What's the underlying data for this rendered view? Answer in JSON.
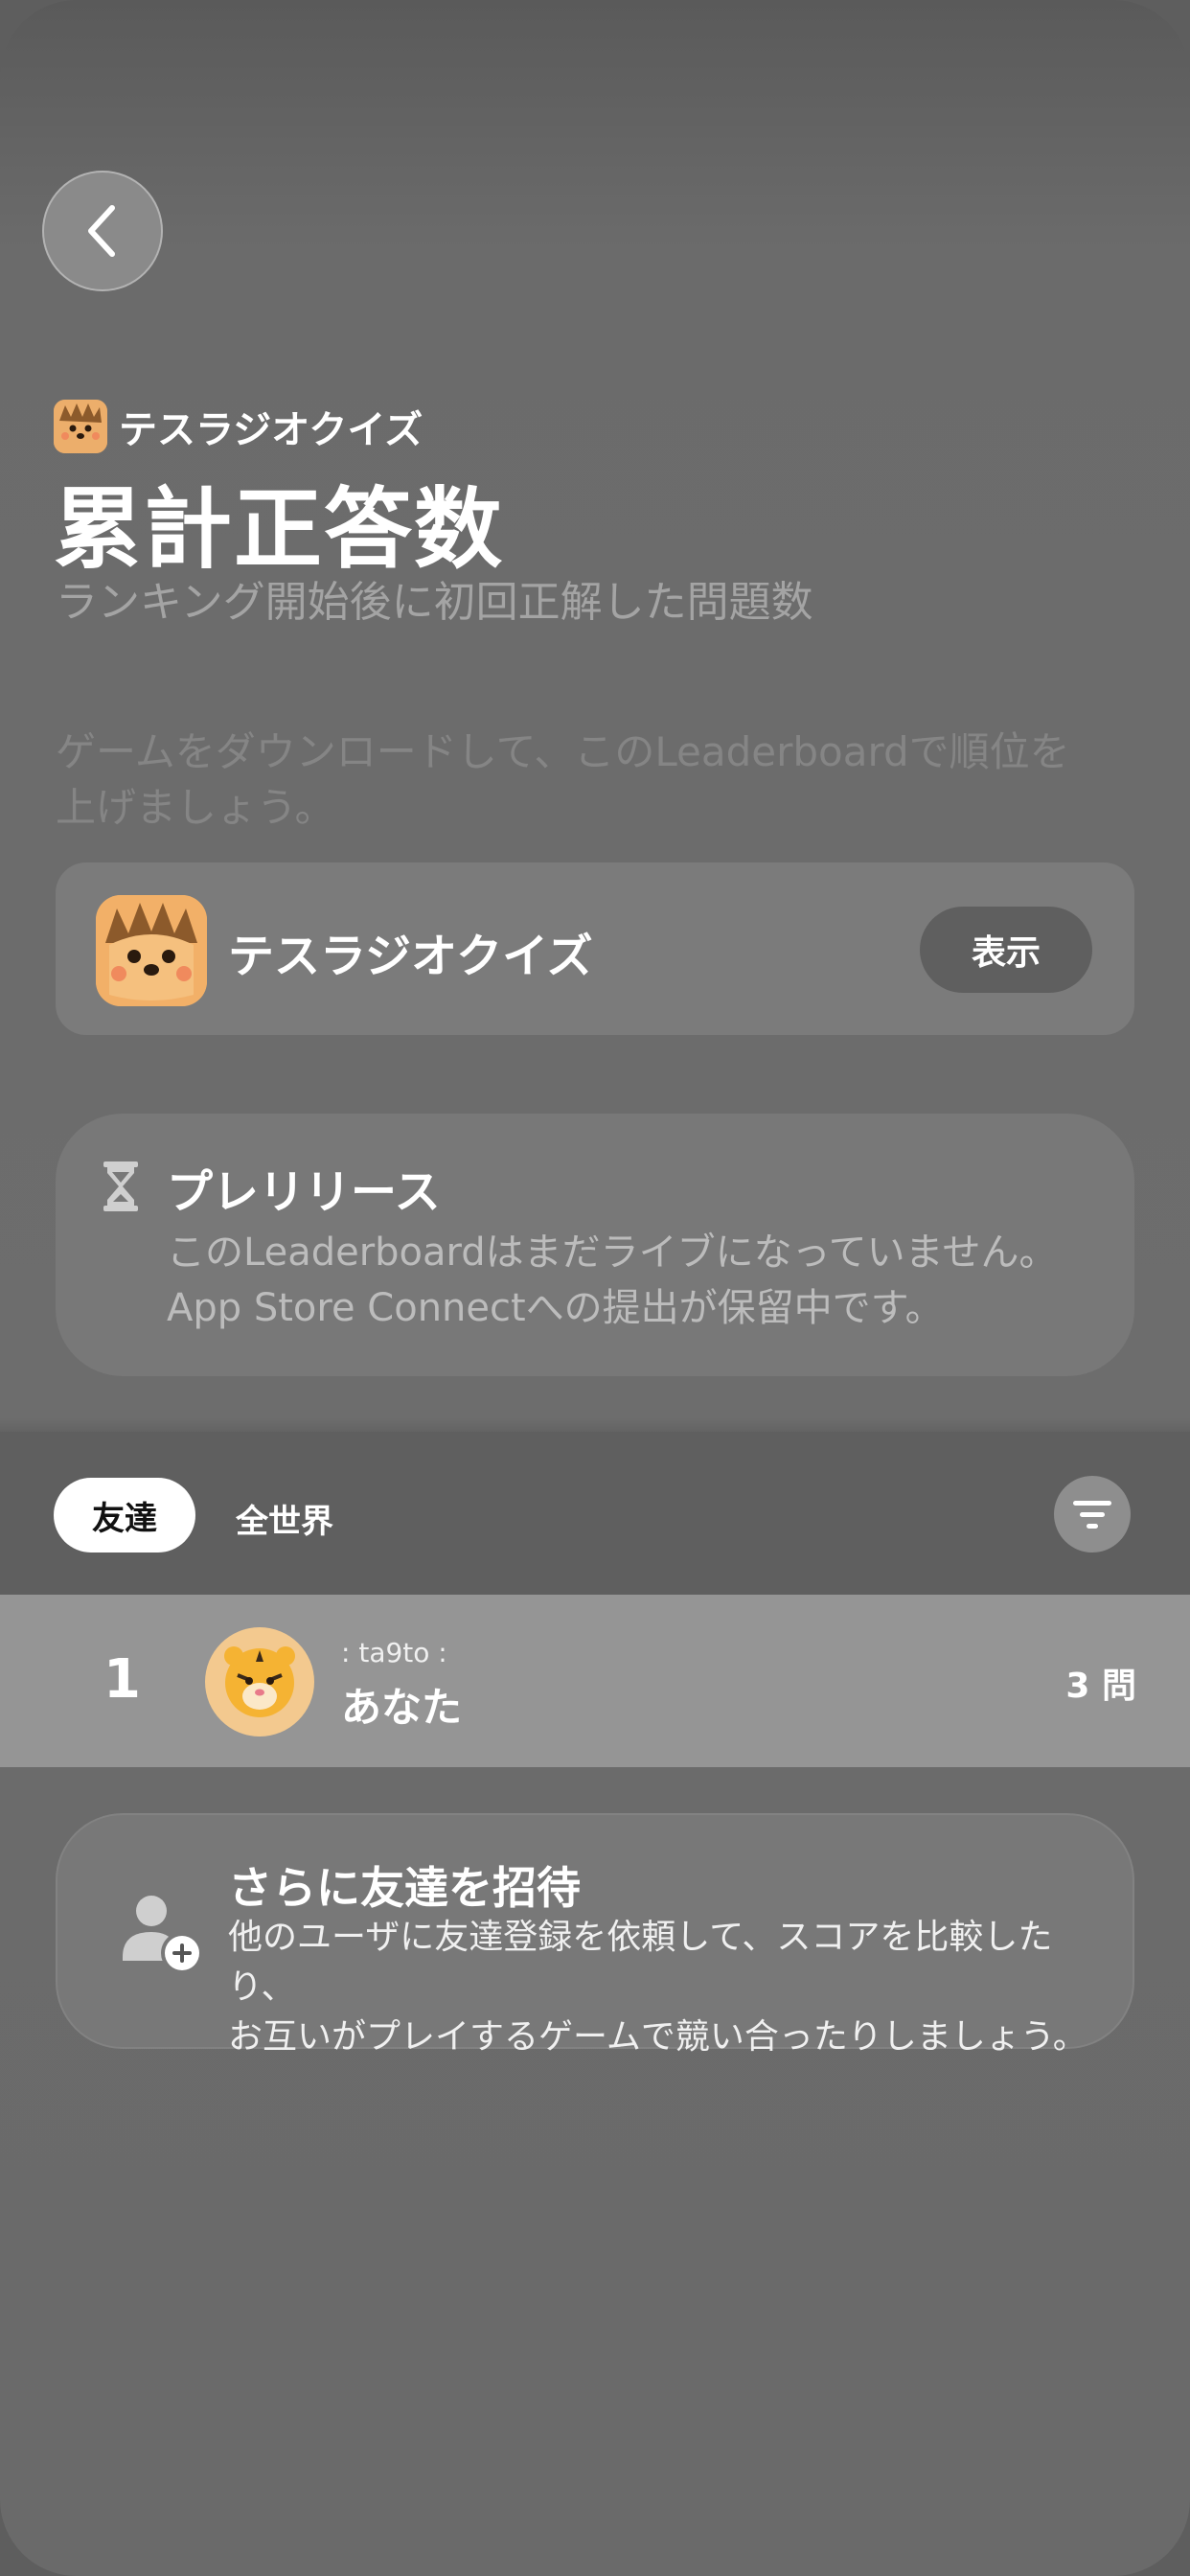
{
  "header": {
    "game_name": "テスラジオクイズ",
    "title": "累計正答数",
    "subtitle": "ランキング開始後に初回正解した問題数"
  },
  "promo": {
    "text": "ゲームをダウンロードして、このLeaderboardで順位を上げましょう。"
  },
  "game_card": {
    "name": "テスラジオクイズ",
    "view_label": "表示",
    "icon": "hedgehog-icon"
  },
  "prerelease": {
    "title": "プレリリース",
    "line1": "このLeaderboardはまだライブになっていません。",
    "line2": "App Store Connectへの提出が保留中です。",
    "icon": "hourglass-icon"
  },
  "tabs": {
    "friends": "友達",
    "global": "全世界"
  },
  "leaderboard": {
    "rows": [
      {
        "rank": "1",
        "handle": ": ta9to :",
        "name": "あなた",
        "score": "3 問",
        "avatar": "🐯"
      }
    ]
  },
  "invite": {
    "title": "さらに友達を招待",
    "line1": "他のユーザに友達登録を依頼して、スコアを比較したり、",
    "line2": "お互いがプレイするゲームで競い合ったりしましょう。",
    "icon": "add-person-icon"
  },
  "colors": {
    "background": "#6b6b6b",
    "card": "#7b7b7b",
    "highlight_row": "#959595"
  }
}
